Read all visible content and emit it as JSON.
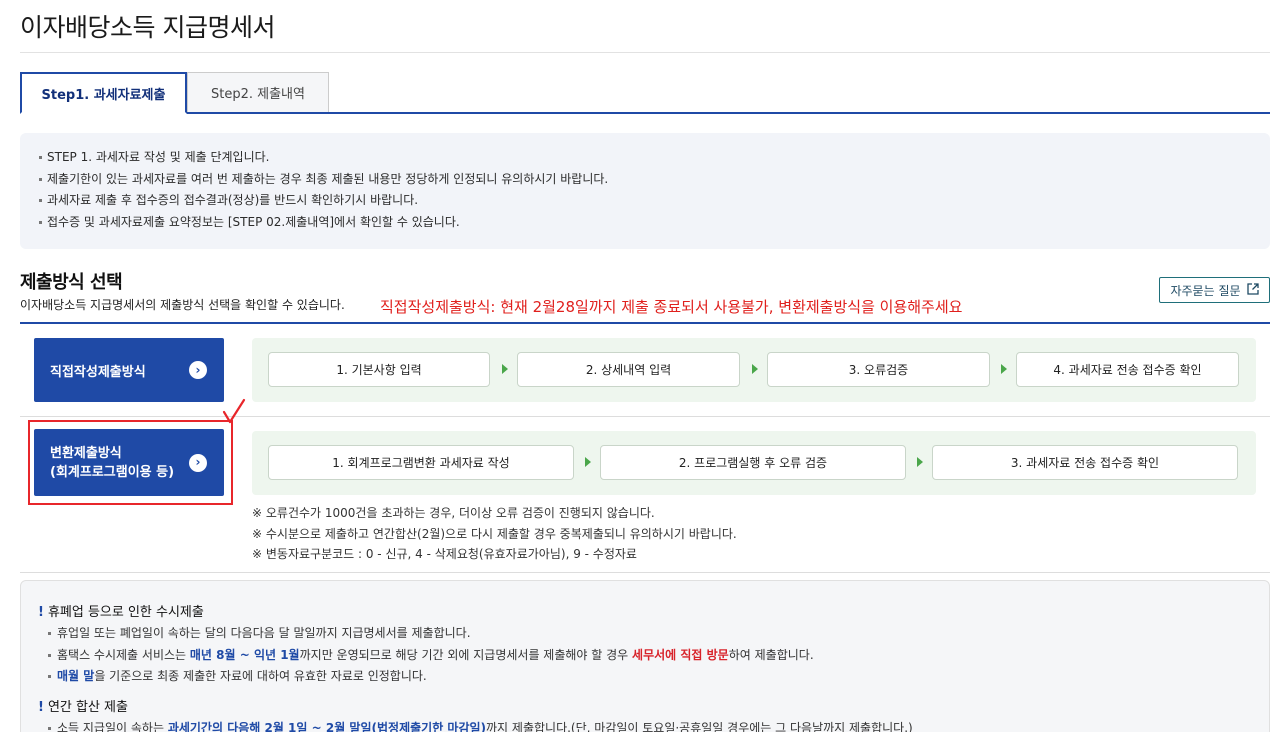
{
  "page": {
    "title": "이자배당소득 지급명세서"
  },
  "tabs": [
    {
      "label": "Step1. 과세자료제출",
      "active": true
    },
    {
      "label": "Step2. 제출내역",
      "active": false
    }
  ],
  "info": [
    "STEP 1. 과세자료 작성 및 제출 단계입니다.",
    "제출기한이 있는 과세자료를 여러 번 제출하는 경우 최종 제출된 내용만 정당하게 인정되니 유의하시기 바랍니다.",
    "과세자료 제출 후 접수증의 접수결과(정상)를 반드시 확인하기시 바랍니다.",
    "접수증 및 과세자료제출 요약정보는 [STEP 02.제출내역]에서 확인할 수 있습니다."
  ],
  "method": {
    "title": "제출방식 선택",
    "description": "이자배당소득 지급명세서의 제출방식 선택을 확인할 수 있습니다.",
    "red_note": "직접작성제출방식: 현재 2월28일까지 제출 종료되서 사용불가, 변환제출방식을 이용해주세요",
    "faq_label": "자주묻는 질문",
    "direct": {
      "label": "직접작성제출방식",
      "steps": [
        "1. 기본사항 입력",
        "2. 상세내역 입력",
        "3. 오류검증",
        "4. 과세자료 전송 접수증 확인"
      ]
    },
    "convert": {
      "label_line1": "변환제출방식",
      "label_line2": "(회계프로그램이용 등)",
      "steps": [
        "1. 회계프로그램변환 과세자료 작성",
        "2. 프로그램실행 후 오류 검증",
        "3. 과세자료 전송 접수증 확인"
      ]
    },
    "warnings": [
      "※ 오류건수가 1000건을 초과하는 경우, 더이상 오류 검증이 진행되지 않습니다.",
      "※ 수시분으로 제출하고 연간합산(2월)으로 다시 제출할 경우 중복제출되니 유의하시기 바랍니다.",
      "※ 변동자료구분코드 : 0 - 신규, 4 - 삭제요청(유효자료가아님), 9 - 수정자료"
    ]
  },
  "notice": {
    "heading1": "휴폐업 등으로 인한 수시제출",
    "line1": "휴업일 또는 폐업일이 속하는 달의 다음다음 달 말일까지 지급명세서를 제출합니다.",
    "line2_a": "홈택스 수시제출 서비스는 ",
    "line2_b": "매년 8월 ~ 익년 1월",
    "line2_c": "까지만 운영되므로 해당 기간 외에 지급명세서를 제출해야 할 경우 ",
    "line2_d": "세무서에 직접 방문",
    "line2_e": "하여 제출합니다.",
    "line3_a": "매월 말",
    "line3_b": "을 기준으로 최종 제출한 자료에 대하여 유효한 자료로 인정합니다.",
    "heading2": "연간 합산 제출",
    "line4_a": "소득 지급일이 속하는 ",
    "line4_b": "과세기간의 다음해 2월 1일 ~ 2월 말일(법정제출기한 마감일)",
    "line4_c": "까지 제출합니다.(단, 마감일이 토요일·공휴일일 경우에는 그 다음날까지 제출합니다.)"
  },
  "colors": {
    "accent": "#1f4aa6",
    "alert": "#e0201d",
    "step_bg": "#eef6ee"
  }
}
